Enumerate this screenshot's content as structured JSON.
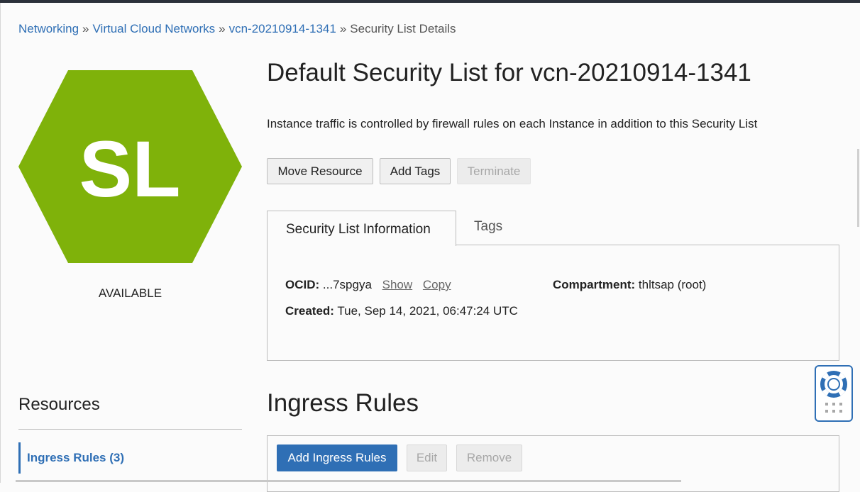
{
  "breadcrumb": {
    "items": [
      "Networking",
      "Virtual Cloud Networks",
      "vcn-20210914-1341"
    ],
    "separator": "»",
    "current": "Security List Details"
  },
  "resource_icon": {
    "text": "SL",
    "color": "#7fb20a",
    "shape": "hexagon"
  },
  "status": "AVAILABLE",
  "page_title": "Default Security List for vcn-20210914-1341",
  "description": "Instance traffic is controlled by firewall rules on each Instance in addition to this Security List",
  "actions": {
    "move_resource": "Move Resource",
    "add_tags": "Add Tags",
    "terminate": "Terminate"
  },
  "tabs": {
    "info": "Security List Information",
    "tags": "Tags"
  },
  "info": {
    "ocid_label": "OCID:",
    "ocid_value": "...7spgya",
    "show": "Show",
    "copy": "Copy",
    "created_label": "Created:",
    "created_value": "Tue, Sep 14, 2021, 06:47:24 UTC",
    "compartment_label": "Compartment:",
    "compartment_value": "thltsap (root)"
  },
  "resources": {
    "title": "Resources",
    "items": [
      {
        "label": "Ingress Rules (3)"
      }
    ]
  },
  "ingress": {
    "title": "Ingress Rules",
    "add": "Add Ingress Rules",
    "edit": "Edit",
    "remove": "Remove"
  },
  "colors": {
    "link": "#2f6fb5",
    "primary": "#2f6fb5",
    "hex": "#7fb20a"
  },
  "icons": {
    "help": "lifebuoy-icon",
    "drag": "grip-dots-icon"
  }
}
